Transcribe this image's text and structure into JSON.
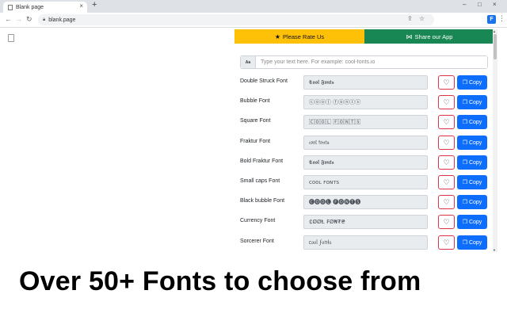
{
  "browser": {
    "tab_title": "Blank page",
    "tab_close": "×",
    "new_tab": "+",
    "window_controls": [
      "–",
      "□",
      "×"
    ],
    "address": "blank.page",
    "nav": {
      "back": "←",
      "forward": "→",
      "reload": "↻"
    },
    "omnibox_icons": [
      "share-icon",
      "star-icon"
    ],
    "extension_icon": "puzzle",
    "menu": "⋮"
  },
  "popup": {
    "rate_button": {
      "label": "Please Rate Us",
      "icon": "★"
    },
    "share_button": {
      "label": "Share our App",
      "icon": "⋈"
    },
    "input": {
      "addon": "Aa",
      "placeholder": "Type your text here. For example: cool-fonts.io",
      "value": ""
    },
    "heart_icon": "♡",
    "copy_label": "Copy",
    "copy_icon": "❐",
    "fonts": [
      {
        "name": "Double Struck Font",
        "preview": "𝕮𝖔𝖔𝖑 𝕱𝖔𝖓𝖙𝖘"
      },
      {
        "name": "Bubble Font",
        "preview": "ⓒⓞⓞⓛ ⓕⓞⓝⓣⓢ"
      },
      {
        "name": "Square Font",
        "preview": "🄲🄾🄾🄻 🄵🄾🄽🅃🅂"
      },
      {
        "name": "Fraktur Font",
        "preview": "𝔠𝔬𝔬𝔩 𝔣𝔬𝔫𝔱𝔰"
      },
      {
        "name": "Bold Fraktur Font",
        "preview": "𝕮𝖔𝖔𝖑 𝕱𝖔𝖓𝖙𝖘"
      },
      {
        "name": "Small caps Font",
        "preview": "ᴄᴏᴏʟ ꜰᴏɴᴛꜱ"
      },
      {
        "name": "Black bubble Font",
        "preview": "🅒🅞🅞🅛 🅕🅞🅝🅣🅢"
      },
      {
        "name": "Currency Font",
        "preview": "₵ØØⱠ ₣Ø₦₮₴"
      },
      {
        "name": "Sorcerer Font",
        "preview": "ᥴ᥆᥆ᥣ ϝ᥆ᥒƚ᥉"
      }
    ]
  },
  "caption": "Over 50+ Fonts to choose from"
}
